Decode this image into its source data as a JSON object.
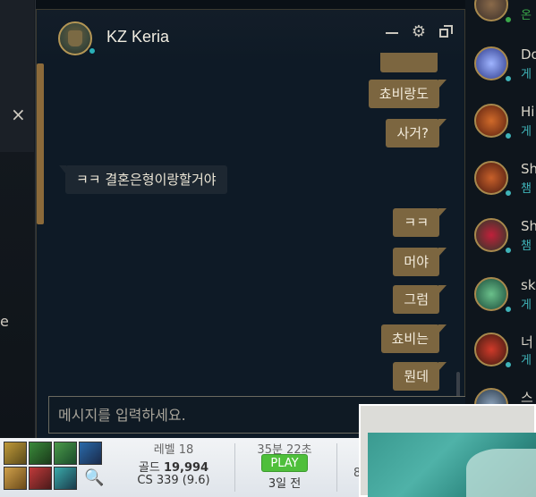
{
  "chat": {
    "contact_name": "KZ Keria",
    "status_color": "#2ab0b8",
    "input_placeholder": "메시지를 입력하세요.",
    "messages": [
      {
        "dir": "out",
        "text": "쵸비랑도"
      },
      {
        "dir": "out",
        "text": "사거?"
      },
      {
        "dir": "in",
        "text": "ㅋㅋ 결혼은형이랑할거야"
      },
      {
        "dir": "out",
        "text": "ㅋㅋ"
      },
      {
        "dir": "out",
        "text": "머야"
      },
      {
        "dir": "out",
        "text": "그럼"
      },
      {
        "dir": "out",
        "text": "쵸비는"
      },
      {
        "dir": "out",
        "text": "뭔데"
      }
    ],
    "header_icons": [
      "minimize-icon",
      "gear-icon",
      "popout-icon"
    ]
  },
  "left_panel": {
    "close_glyph": "×",
    "partial_text": "e"
  },
  "friends": [
    {
      "name": "",
      "status": "온",
      "dot": "#3aa84a"
    },
    {
      "name": "Do",
      "status": "게",
      "dot": "#3fb3b8"
    },
    {
      "name": "Hi",
      "status": "게",
      "dot": "#3fb3b8"
    },
    {
      "name": "Sh",
      "status": "챔",
      "dot": "#3fb3b8"
    },
    {
      "name": "Sh",
      "status": "챔",
      "dot": "#3fb3b8"
    },
    {
      "name": "sk",
      "status": "게",
      "dot": "#3fb3b8"
    },
    {
      "name": "너",
      "status": "게",
      "dot": "#3fb3b8"
    },
    {
      "name": "스",
      "status": "",
      "dot": "#3fb3b8"
    }
  ],
  "game_stats": {
    "level_label": "레벨 18",
    "gold_label": "골드",
    "gold_value": "19,994",
    "cs_label": "CS 339 (9.6)",
    "duration": "35분 22초",
    "play_label": "PLAY",
    "ago": "3일 전",
    "extra": "8"
  }
}
